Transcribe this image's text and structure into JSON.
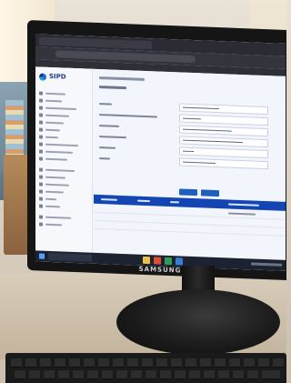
{
  "monitor": {
    "brand": "SAMSUNG"
  },
  "app": {
    "logo_text": "SIPD"
  },
  "colors": {
    "table_header": "#1346b3",
    "button": "#1f5fbf",
    "screen_bg": "#eaf0f8"
  },
  "icons": [
    "logo-icon",
    "windows-start-icon"
  ]
}
